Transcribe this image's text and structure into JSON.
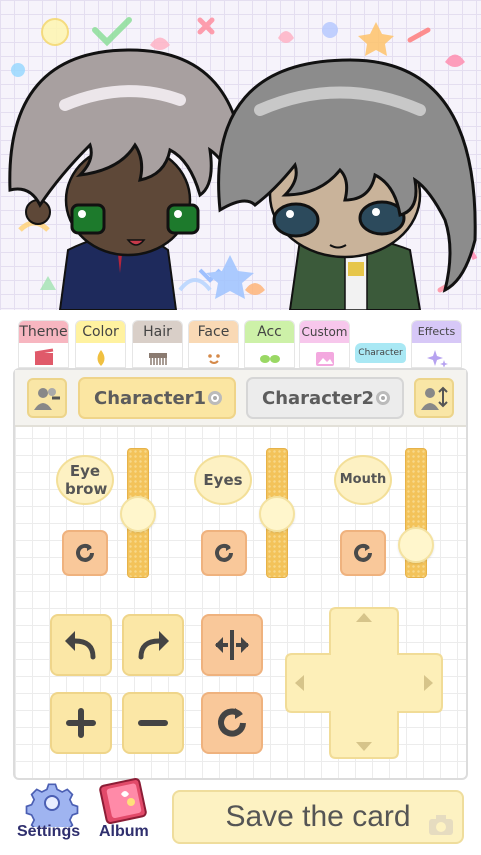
{
  "tabs": [
    {
      "label": "Theme",
      "color": "#f7b6c0",
      "icon": "clapperboard-icon"
    },
    {
      "label": "Color",
      "color": "#fff2a0",
      "icon": "droplet-icon"
    },
    {
      "label": "Hair",
      "color": "#d9cfc8",
      "icon": "comb-icon"
    },
    {
      "label": "Face",
      "color": "#f9d9b5",
      "icon": "smile-face-icon"
    },
    {
      "label": "Acc",
      "color": "#cdf1a8",
      "icon": "glasses-icon"
    },
    {
      "label": "Custom",
      "color": "#f7c7ec",
      "icon": "image-icon"
    },
    {
      "label": "Character",
      "color": "#a9e8f4",
      "icon": ""
    },
    {
      "label": "Effects",
      "color": "#d7c8f7",
      "icon": "sparkle-icon"
    }
  ],
  "active_tab": "Character",
  "characters": {
    "char1_label": "Character1",
    "char2_label": "Character2",
    "selected": "Character1"
  },
  "adjust": {
    "eyebrow_label": "Eye brow",
    "eyes_label": "Eyes",
    "mouth_label": "Mouth",
    "eyebrow_level": 0.5,
    "eyes_level": 0.5,
    "mouth_level": 0.17
  },
  "bottom": {
    "settings_label": "Settings",
    "album_label": "Album",
    "save_label": "Save the card"
  },
  "colors": {
    "accent_yellow": "#fbe7a6",
    "accent_orange": "#f9c89a",
    "slider": "#f3c35a"
  }
}
